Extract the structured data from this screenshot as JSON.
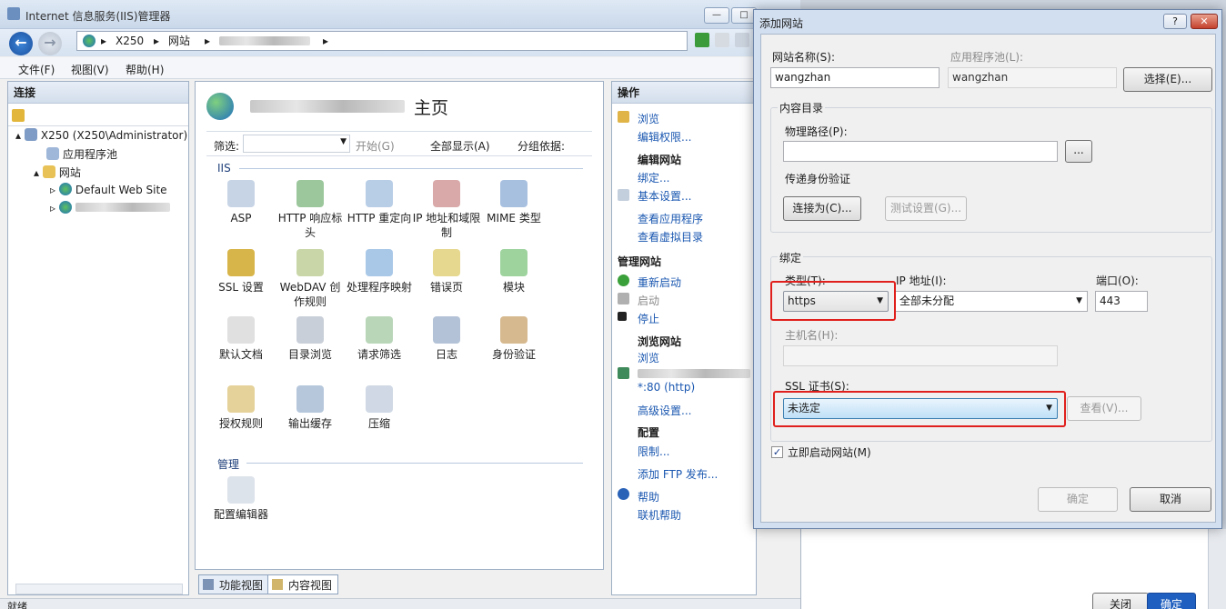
{
  "window": {
    "title": "Internet 信息服务(IIS)管理器",
    "breadcrumb": [
      "X250",
      "网站"
    ]
  },
  "menu": {
    "file": "文件(F)",
    "view": "视图(V)",
    "help": "帮助(H)"
  },
  "connections": {
    "header": "连接",
    "tree": {
      "server": "X250 (X250\\Administrator)",
      "app_pools": "应用程序池",
      "sites": "网站",
      "default_site": "Default Web Site"
    }
  },
  "center": {
    "title_suffix": "主页",
    "filter_label": "筛选:",
    "start_label": "开始(G)",
    "show_all_label": "全部显示(A)",
    "group_by_label": "分组依据:",
    "section_iis": "IIS",
    "section_manage": "管理",
    "features": [
      "ASP",
      "HTTP 响应标头",
      "HTTP 重定向",
      "IP 地址和域限制",
      "MIME 类型",
      "SSL 设置",
      "WebDAV 创作规则",
      "处理程序映射",
      "错误页",
      "模块",
      "默认文档",
      "目录浏览",
      "请求筛选",
      "日志",
      "身份验证",
      "授权规则",
      "输出缓存",
      "压缩"
    ],
    "manage_features": [
      "配置编辑器"
    ],
    "tab_features": "功能视图",
    "tab_content": "内容视图"
  },
  "actions": {
    "header": "操作",
    "browse": "浏览",
    "edit_perms": "编辑权限...",
    "edit_site_header": "编辑网站",
    "bindings": "绑定...",
    "basic_settings": "基本设置...",
    "view_apps": "查看应用程序",
    "view_vdirs": "查看虚拟目录",
    "manage_site_header": "管理网站",
    "restart": "重新启动",
    "start": "启动",
    "stop": "停止",
    "browse_site_header": "浏览网站",
    "browse2": "浏览",
    "binding_port": "*:80 (http)",
    "advanced": "高级设置...",
    "config_header": "配置",
    "limits": "限制...",
    "add_ftp": "添加 FTP 发布...",
    "help": "帮助",
    "online_help": "联机帮助"
  },
  "dialog": {
    "title": "添加网站",
    "help_btn": "?",
    "site_name_label": "网站名称(S):",
    "site_name_value": "wangzhan",
    "app_pool_label": "应用程序池(L):",
    "app_pool_value": "wangzhan",
    "select_btn": "选择(E)...",
    "content_dir_label": "内容目录",
    "physical_path_label": "物理路径(P):",
    "physical_path_value": "",
    "browse_btn": "...",
    "pass_auth_label": "传递身份验证",
    "connect_as_btn": "连接为(C)...",
    "test_settings_btn": "测试设置(G)...",
    "binding_label": "绑定",
    "type_label": "类型(T):",
    "type_value": "https",
    "ip_label": "IP 地址(I):",
    "ip_value": "全部未分配",
    "port_label": "端口(O):",
    "port_value": "443",
    "hostname_label": "主机名(H):",
    "hostname_value": "",
    "ssl_label": "SSL 证书(S):",
    "ssl_value": "未选定",
    "view_btn": "查看(V)...",
    "start_now_label": "立即启动网站(M)",
    "start_now_checked": true,
    "ok_btn": "确定",
    "cancel_btn": "取消"
  },
  "background_window": {
    "close_btn": "关闭",
    "ok_btn": "确定"
  },
  "status": {
    "text": "就绪"
  }
}
